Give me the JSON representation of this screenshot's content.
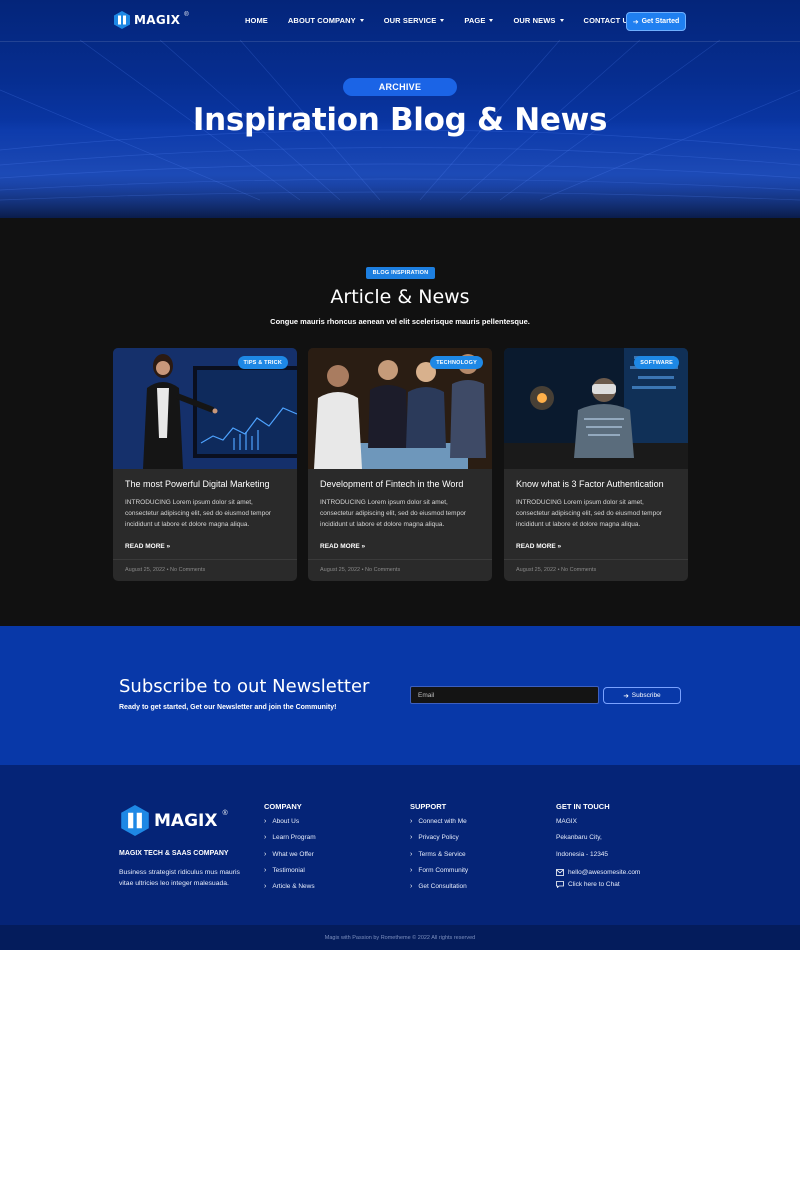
{
  "colors": {
    "primary": "#0838a8",
    "accent": "#1e88e5",
    "dark": "#111111",
    "footer": "#052477"
  },
  "nav": {
    "brand": "MAGIX",
    "reg": "®",
    "items": [
      {
        "label": "HOME",
        "dropdown": false
      },
      {
        "label": "ABOUT COMPANY",
        "dropdown": true
      },
      {
        "label": "OUR SERVICE",
        "dropdown": true
      },
      {
        "label": "PAGE",
        "dropdown": true
      },
      {
        "label": "OUR NEWS",
        "dropdown": true
      },
      {
        "label": "CONTACT US",
        "dropdown": false
      }
    ],
    "cta": "Get Started"
  },
  "hero": {
    "pill": "ARCHIVE",
    "title": "Inspiration Blog & News"
  },
  "articles": {
    "tag": "BLOG INSPIRATION",
    "title": "Article & News",
    "subtitle": "Congue mauris rhoncus aenean vel elit scelerisque mauris pellentesque.",
    "cards": [
      {
        "badge": "TIPS & TRICK",
        "title": "The most Powerful Digital Marketing",
        "body": "INTRODUCING Lorem ipsum dolor sit amet, consectetur adipiscing elit, sed do eiusmod tempor incididunt ut labore et dolore magna aliqua.",
        "more": "READ MORE »",
        "meta": "August 25, 2022  •  No Comments"
      },
      {
        "badge": "TECHNOLOGY",
        "title": "Development of Fintech in the Word",
        "body": "INTRODUCING Lorem ipsum dolor sit amet, consectetur adipiscing elit, sed do eiusmod tempor incididunt ut labore et dolore magna aliqua.",
        "more": "READ MORE »",
        "meta": "August 25, 2022  •  No Comments"
      },
      {
        "badge": "SOFTWARE",
        "title": "Know what is 3 Factor Authentication",
        "body": "INTRODUCING Lorem ipsum dolor sit amet, consectetur adipiscing elit, sed do eiusmod tempor incididunt ut labore et dolore magna aliqua.",
        "more": "READ MORE »",
        "meta": "August 25, 2022  •  No Comments"
      }
    ]
  },
  "newsletter": {
    "title": "Subscribe to out Newsletter",
    "subtitle": "Ready to get started, Get our Newsletter and join the Community!",
    "email_placeholder": "Email",
    "button": "Subscribe"
  },
  "footer": {
    "brand": "MAGIX",
    "reg": "®",
    "company_name": "MAGIX TECH & SAAS COMPANY",
    "description": "Business strategist ridiculus mus mauris vitae ultricies leo integer malesuada.",
    "company": {
      "heading": "COMPANY",
      "links": [
        "About Us",
        "Learn Program",
        "What we Offer",
        "Testimonial",
        "Article & News"
      ]
    },
    "support": {
      "heading": "SUPPORT",
      "links": [
        "Connect with Me",
        "Privacy Policy",
        "Terms & Service",
        "Form Community",
        "Get Consultation"
      ]
    },
    "touch": {
      "heading": "GET IN TOUCH",
      "lines": [
        "MAGIX",
        "Pekanbaru City,",
        "Indonesia - 12345"
      ],
      "email": "hello@awesomesite.com",
      "chat": "Click here to Chat"
    },
    "copyright": "Magix with Passion by Rometheme © 2022 All rights reserved"
  }
}
